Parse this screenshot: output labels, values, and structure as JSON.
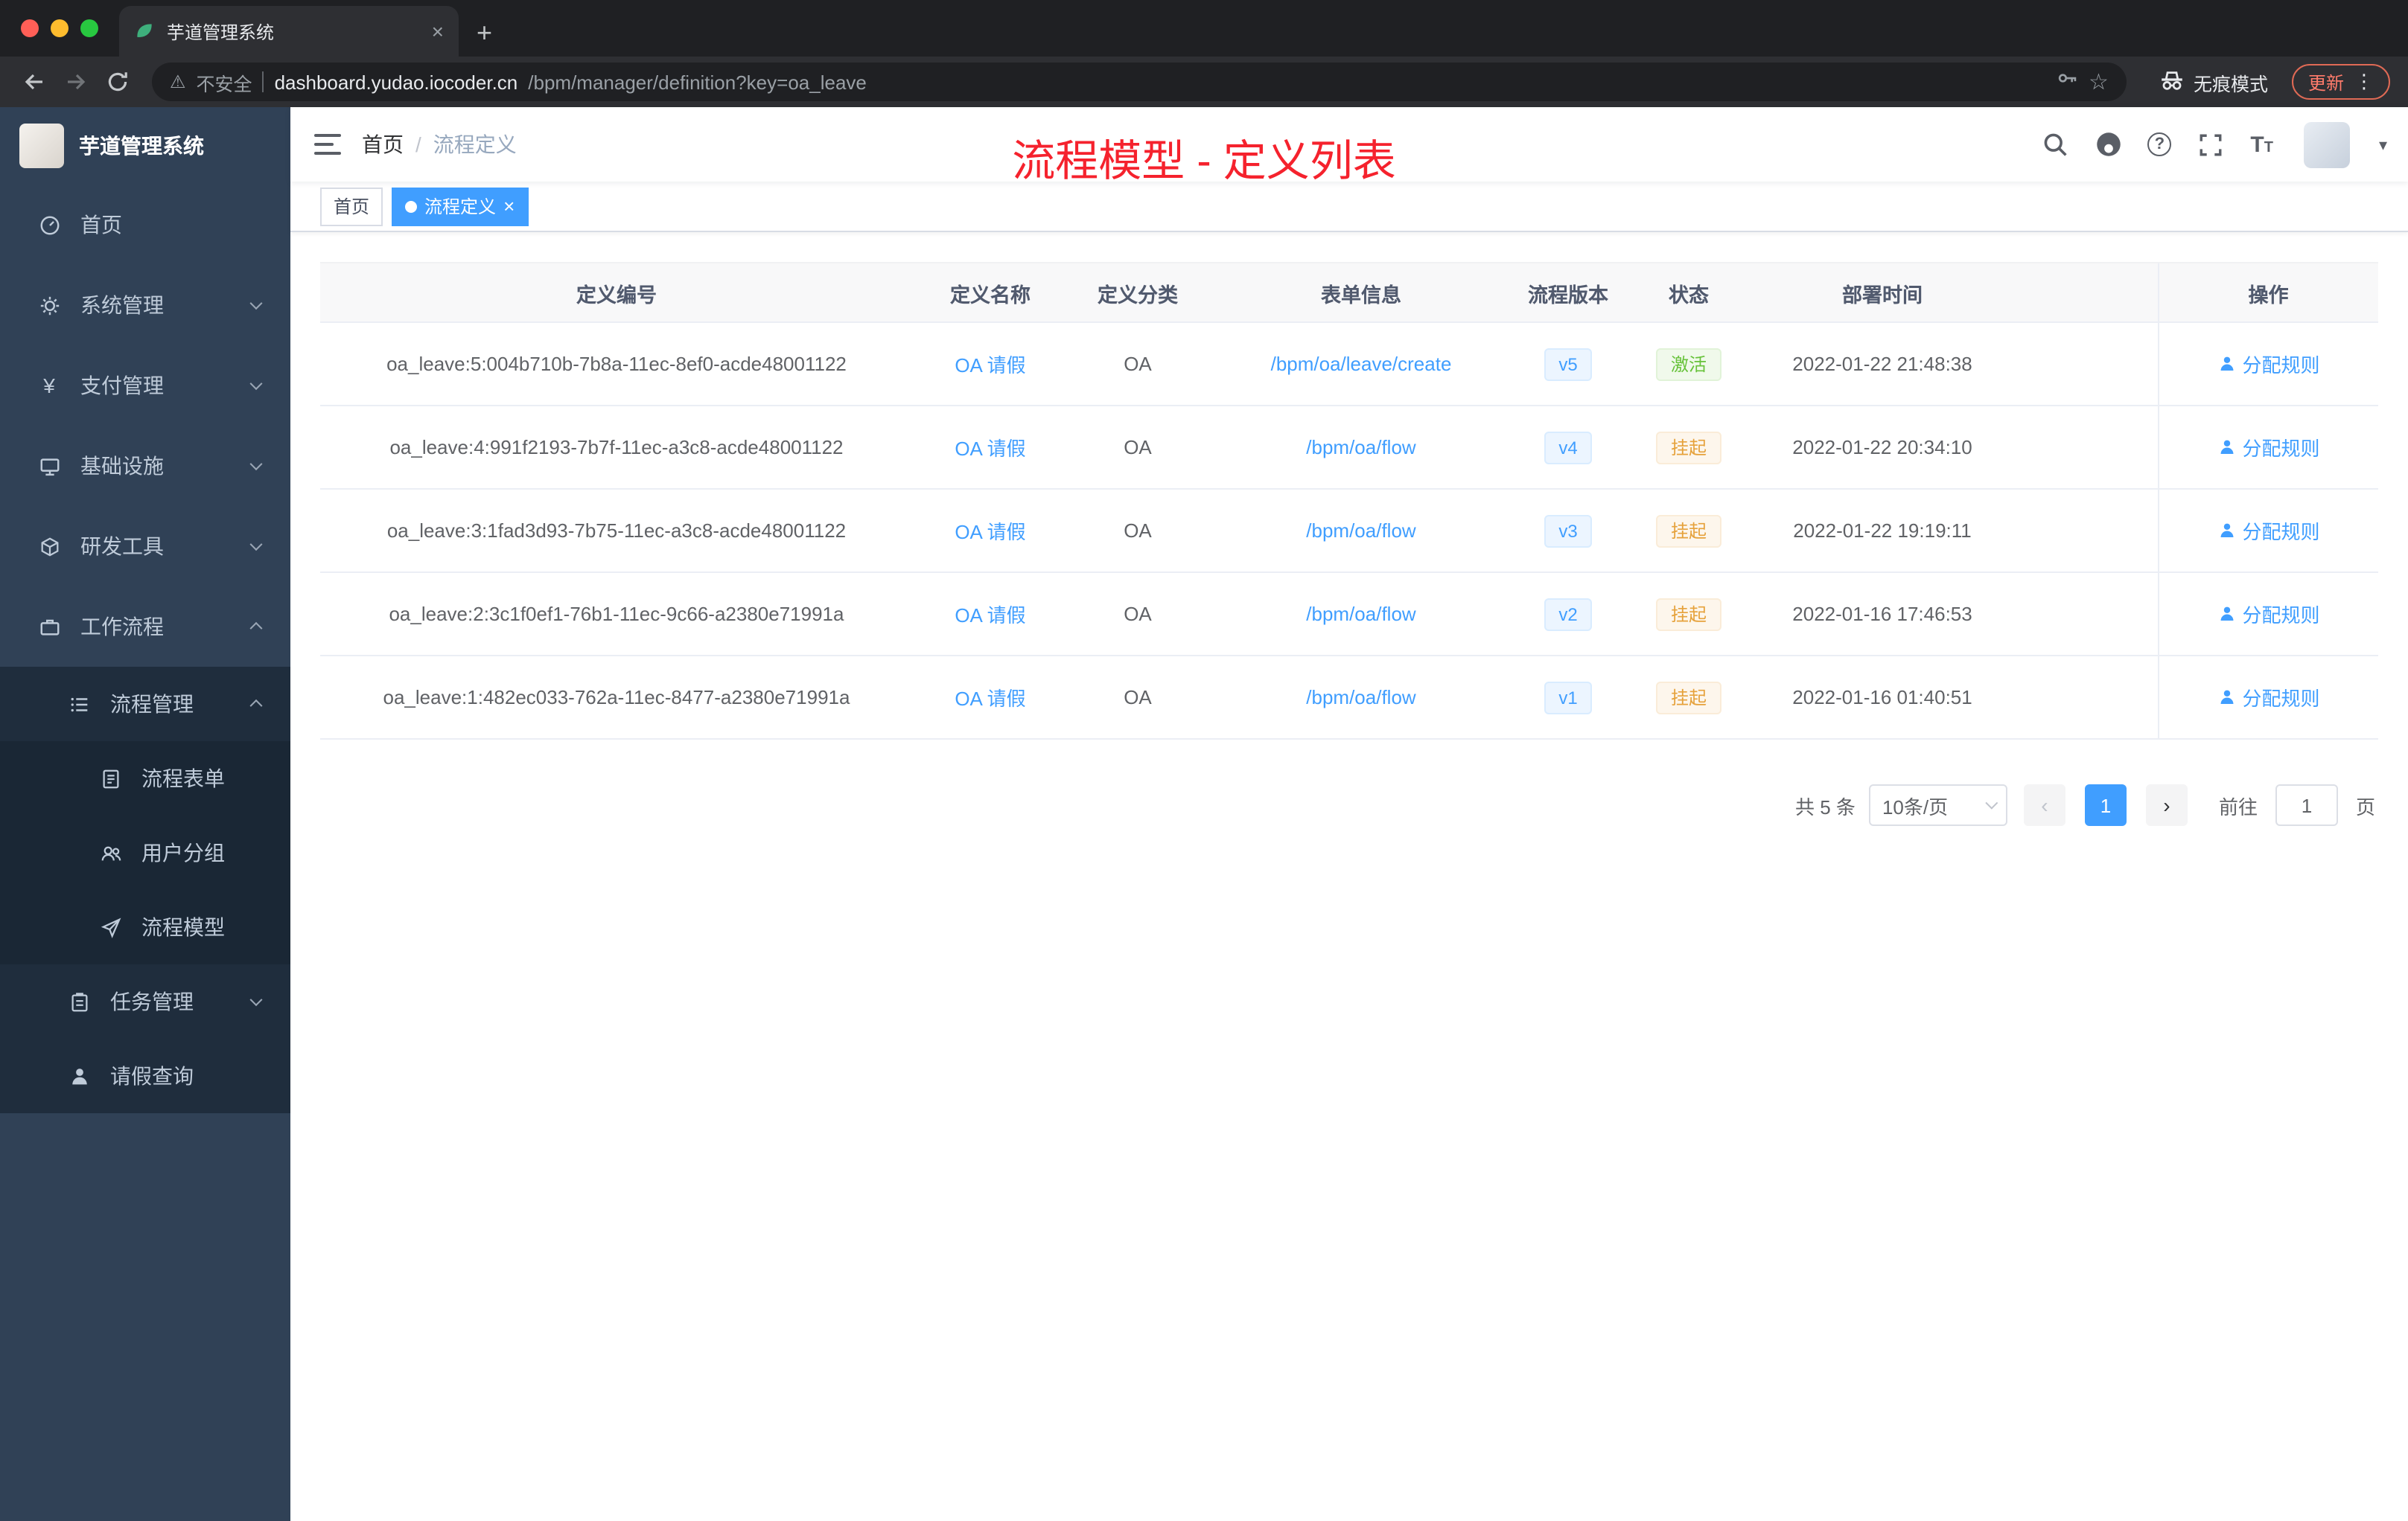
{
  "browser": {
    "tab_title": "芋道管理系统",
    "security_label": "不安全",
    "url_host": "dashboard.yudao.iocoder.cn",
    "url_path": "/bpm/manager/definition?key=oa_leave",
    "incognito_label": "无痕模式",
    "update_label": "更新"
  },
  "icons": {
    "close": "×",
    "plus": "+",
    "kebab": "⋮",
    "star": "☆",
    "warning": "⚠",
    "question": "?",
    "font_t": "T",
    "caret_down": "▾",
    "prev": "‹",
    "next": "›",
    "breadcrumb_separator": "/"
  },
  "sidebar": {
    "title": "芋道管理系统",
    "items": [
      {
        "label": "首页"
      },
      {
        "label": "系统管理"
      },
      {
        "label": "支付管理"
      },
      {
        "label": "基础设施"
      },
      {
        "label": "研发工具"
      },
      {
        "label": "工作流程"
      },
      {
        "label": "流程管理"
      },
      {
        "label": "流程表单"
      },
      {
        "label": "用户分组"
      },
      {
        "label": "流程模型"
      },
      {
        "label": "任务管理"
      },
      {
        "label": "请假查询"
      }
    ]
  },
  "navbar": {
    "breadcrumb_home": "首页",
    "breadcrumb_current": "流程定义",
    "annotation": "流程模型 - 定义列表"
  },
  "tags": {
    "home": "首页",
    "active": "流程定义"
  },
  "table": {
    "columns": [
      "定义编号",
      "定义名称",
      "定义分类",
      "表单信息",
      "流程版本",
      "状态",
      "部署时间",
      "操作"
    ],
    "action_label": "分配规则",
    "rows": [
      {
        "id": "oa_leave:5:004b710b-7b8a-11ec-8ef0-acde48001122",
        "name": "OA 请假",
        "category": "OA",
        "form": "/bpm/oa/leave/create",
        "version": "v5",
        "status": "激活",
        "time": "2022-01-22 21:48:38"
      },
      {
        "id": "oa_leave:4:991f2193-7b7f-11ec-a3c8-acde48001122",
        "name": "OA 请假",
        "category": "OA",
        "form": "/bpm/oa/flow",
        "version": "v4",
        "status": "挂起",
        "time": "2022-01-22 20:34:10"
      },
      {
        "id": "oa_leave:3:1fad3d93-7b75-11ec-a3c8-acde48001122",
        "name": "OA 请假",
        "category": "OA",
        "form": "/bpm/oa/flow",
        "version": "v3",
        "status": "挂起",
        "time": "2022-01-22 19:19:11"
      },
      {
        "id": "oa_leave:2:3c1f0ef1-76b1-11ec-9c66-a2380e71991a",
        "name": "OA 请假",
        "category": "OA",
        "form": "/bpm/oa/flow",
        "version": "v2",
        "status": "挂起",
        "time": "2022-01-16 17:46:53"
      },
      {
        "id": "oa_leave:1:482ec033-762a-11ec-8477-a2380e71991a",
        "name": "OA 请假",
        "category": "OA",
        "form": "/bpm/oa/flow",
        "version": "v1",
        "status": "挂起",
        "time": "2022-01-16 01:40:51"
      }
    ]
  },
  "pagination": {
    "total": "共 5 条",
    "page_size": "10条/页",
    "current_page": "1",
    "goto_label": "前往",
    "goto_value": "1",
    "goto_suffix": "页"
  },
  "colors": {
    "accent": "#409eff",
    "success": "#67c23a",
    "warning": "#e6a23c",
    "annotation_red": "#f5222d",
    "sidebar_bg": "#304156",
    "sidebar_sub_bg": "#1f2d3d"
  }
}
